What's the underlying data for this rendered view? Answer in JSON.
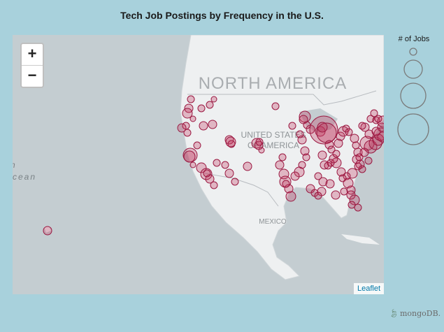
{
  "title": "Tech Job Postings by Frequency in the U.S.",
  "map": {
    "zoom_in_label": "+",
    "zoom_out_label": "−",
    "attribution": "Leaflet",
    "labels": {
      "continent": "NORTH AMERICA",
      "country_line1": "UNITED STATES",
      "country_line2": "OF AMERICA",
      "mexico": "MEXICO",
      "ocean_fragment": "cean",
      "ocean_fragment2": "n"
    }
  },
  "legend": {
    "title": "# of Jobs"
  },
  "brand": {
    "icon": "leaf-icon",
    "name": "mongoDB."
  },
  "colors": {
    "page_bg": "#a8d1dc",
    "water": "#c4cdd1",
    "land": "#eef0f1",
    "marker_fill": "#c0315a",
    "marker_stroke": "#9a1740"
  }
}
